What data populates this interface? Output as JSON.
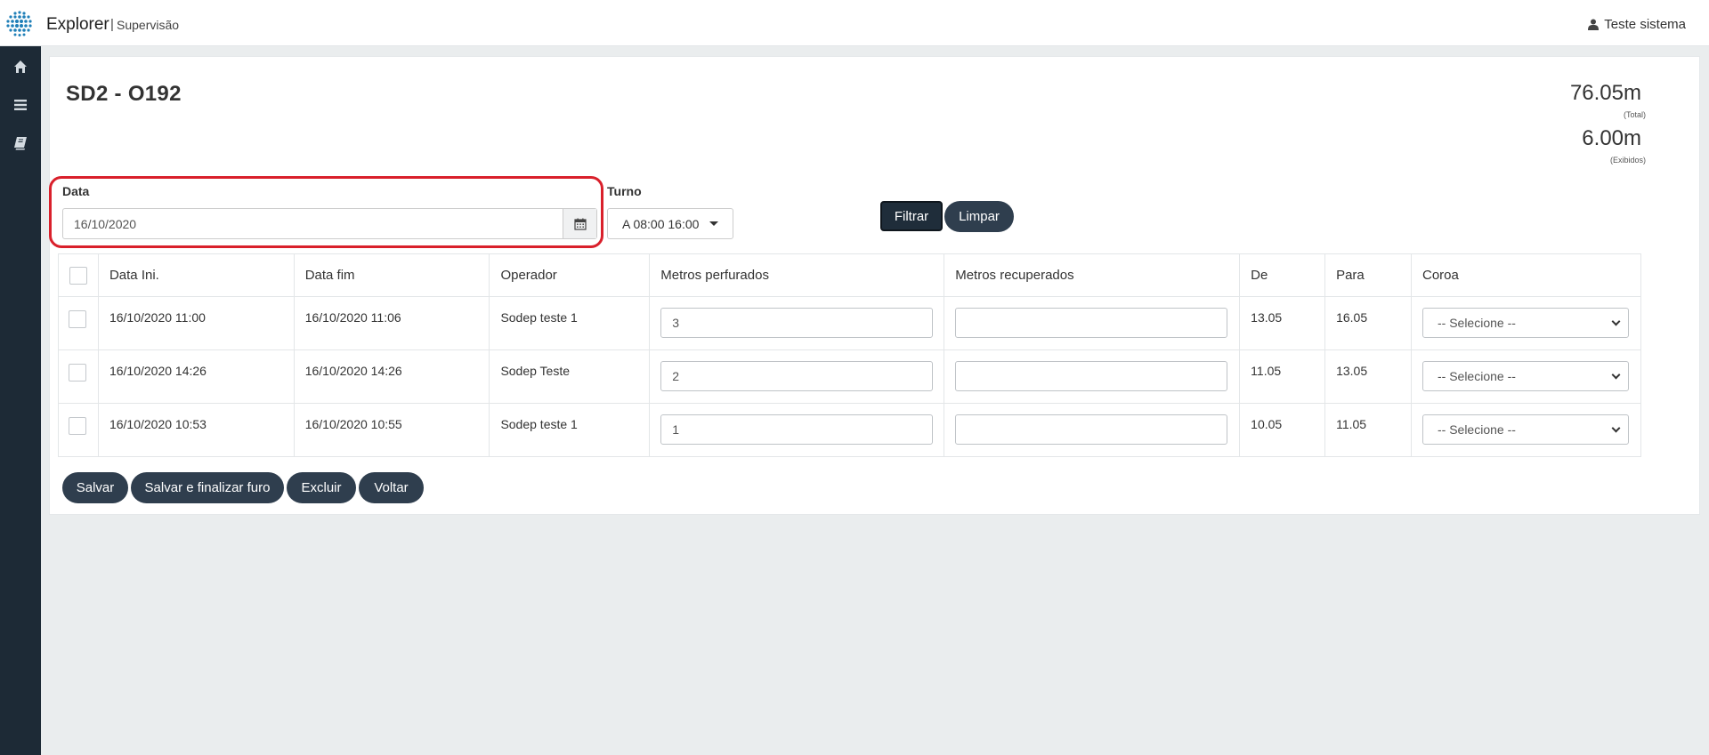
{
  "app": {
    "name": "Explorer",
    "separator": "|",
    "section": "Supervisão"
  },
  "user": {
    "name": "Teste sistema",
    "icon": "user-icon"
  },
  "sidebar": {
    "items": [
      {
        "icon": "home-icon"
      },
      {
        "icon": "menu-icon"
      },
      {
        "icon": "book-icon"
      }
    ]
  },
  "page": {
    "title": "SD2 - O192"
  },
  "stats": {
    "total_value": "76.05m",
    "total_label": "(Total)",
    "shown_value": "6.00m",
    "shown_label": "(Exibidos)"
  },
  "filter": {
    "date_label": "Data",
    "date_value": "16/10/2020",
    "turno_label": "Turno",
    "turno_value": "A 08:00 16:00",
    "filter_button": "Filtrar",
    "clear_button": "Limpar"
  },
  "table": {
    "headers": [
      "Data Ini.",
      "Data fim",
      "Operador",
      "Metros perfurados",
      "Metros recuperados",
      "De",
      "Para",
      "Coroa"
    ],
    "rows": [
      {
        "start": "16/10/2020 11:00",
        "end": "16/10/2020 11:06",
        "operator": "Sodep teste 1",
        "drilled": "3",
        "recovered": "",
        "from": "13.05",
        "to": "16.05",
        "crown": "-- Selecione --"
      },
      {
        "start": "16/10/2020 14:26",
        "end": "16/10/2020 14:26",
        "operator": "Sodep Teste",
        "drilled": "2",
        "recovered": "",
        "from": "11.05",
        "to": "13.05",
        "crown": "-- Selecione --"
      },
      {
        "start": "16/10/2020 10:53",
        "end": "16/10/2020 10:55",
        "operator": "Sodep teste 1",
        "drilled": "1",
        "recovered": "",
        "from": "10.05",
        "to": "11.05",
        "crown": "-- Selecione --"
      }
    ]
  },
  "actions": {
    "save": "Salvar",
    "save_finish": "Salvar e finalizar furo",
    "delete": "Excluir",
    "back": "Voltar"
  },
  "colors": {
    "navy": "#2f3e4e",
    "sidebar": "#1d2a36",
    "highlight": "#d9202b",
    "logo_blue": "#1f7fb8"
  }
}
